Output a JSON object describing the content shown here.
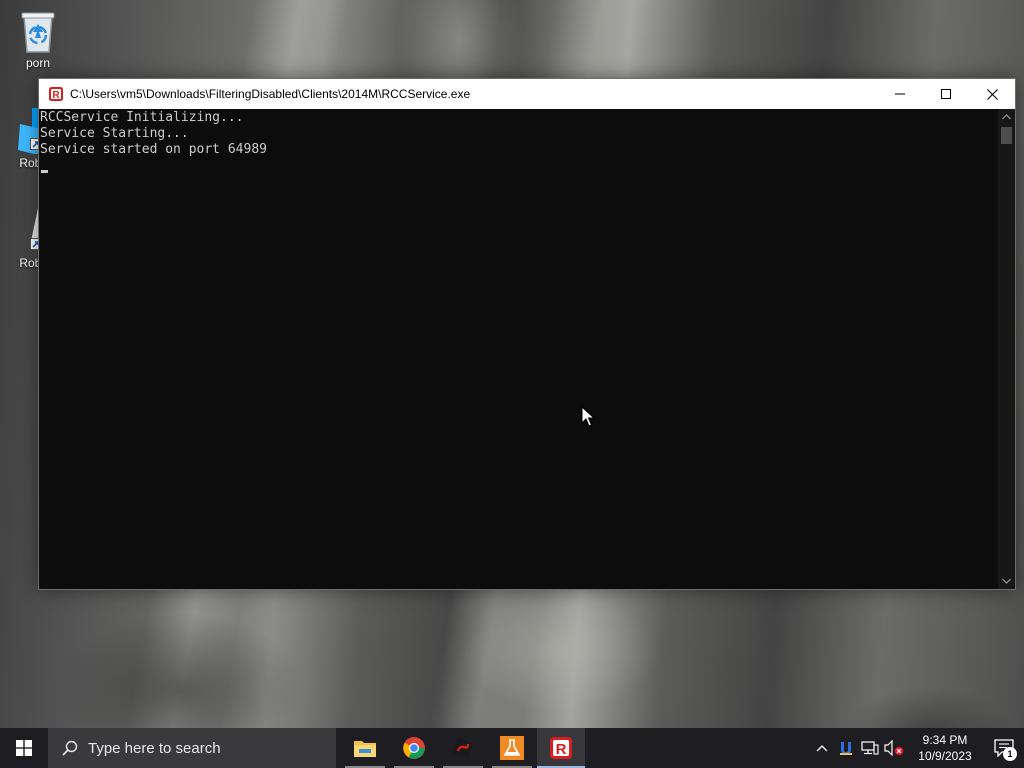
{
  "desktop": {
    "icons": [
      {
        "label": "porn",
        "icon": "recycle-bin-icon"
      },
      {
        "label": "Roblox",
        "icon": "roblox-studio-icon"
      },
      {
        "label": "Roblox",
        "icon": "roblox-player-icon"
      }
    ]
  },
  "window": {
    "title": "C:\\Users\\vm5\\Downloads\\FilteringDisabled\\Clients\\2014M\\RCCService.exe",
    "icon": "rcc-service-icon",
    "controls": [
      "minimize-icon",
      "maximize-icon",
      "close-icon"
    ],
    "console_lines": [
      "RCCService Initializing...",
      "Service Starting...",
      "Service started on port 64989"
    ]
  },
  "taskbar": {
    "search_placeholder": "Type here to search",
    "apps": [
      {
        "name": "File Explorer",
        "icon": "file-explorer-icon"
      },
      {
        "name": "Google Chrome",
        "icon": "chrome-icon"
      },
      {
        "name": "App",
        "icon": "red-swirl-app-icon"
      },
      {
        "name": "App",
        "icon": "flask-app-icon"
      },
      {
        "name": "RCCService",
        "icon": "roblox-r-icon",
        "active": true
      }
    ],
    "tray": {
      "icons": [
        "chevron-up-icon",
        "tray-app-icon",
        "network-icon",
        "volume-muted-icon"
      ],
      "time": "9:34 PM",
      "date": "10/9/2023",
      "notification_count": "1"
    }
  }
}
